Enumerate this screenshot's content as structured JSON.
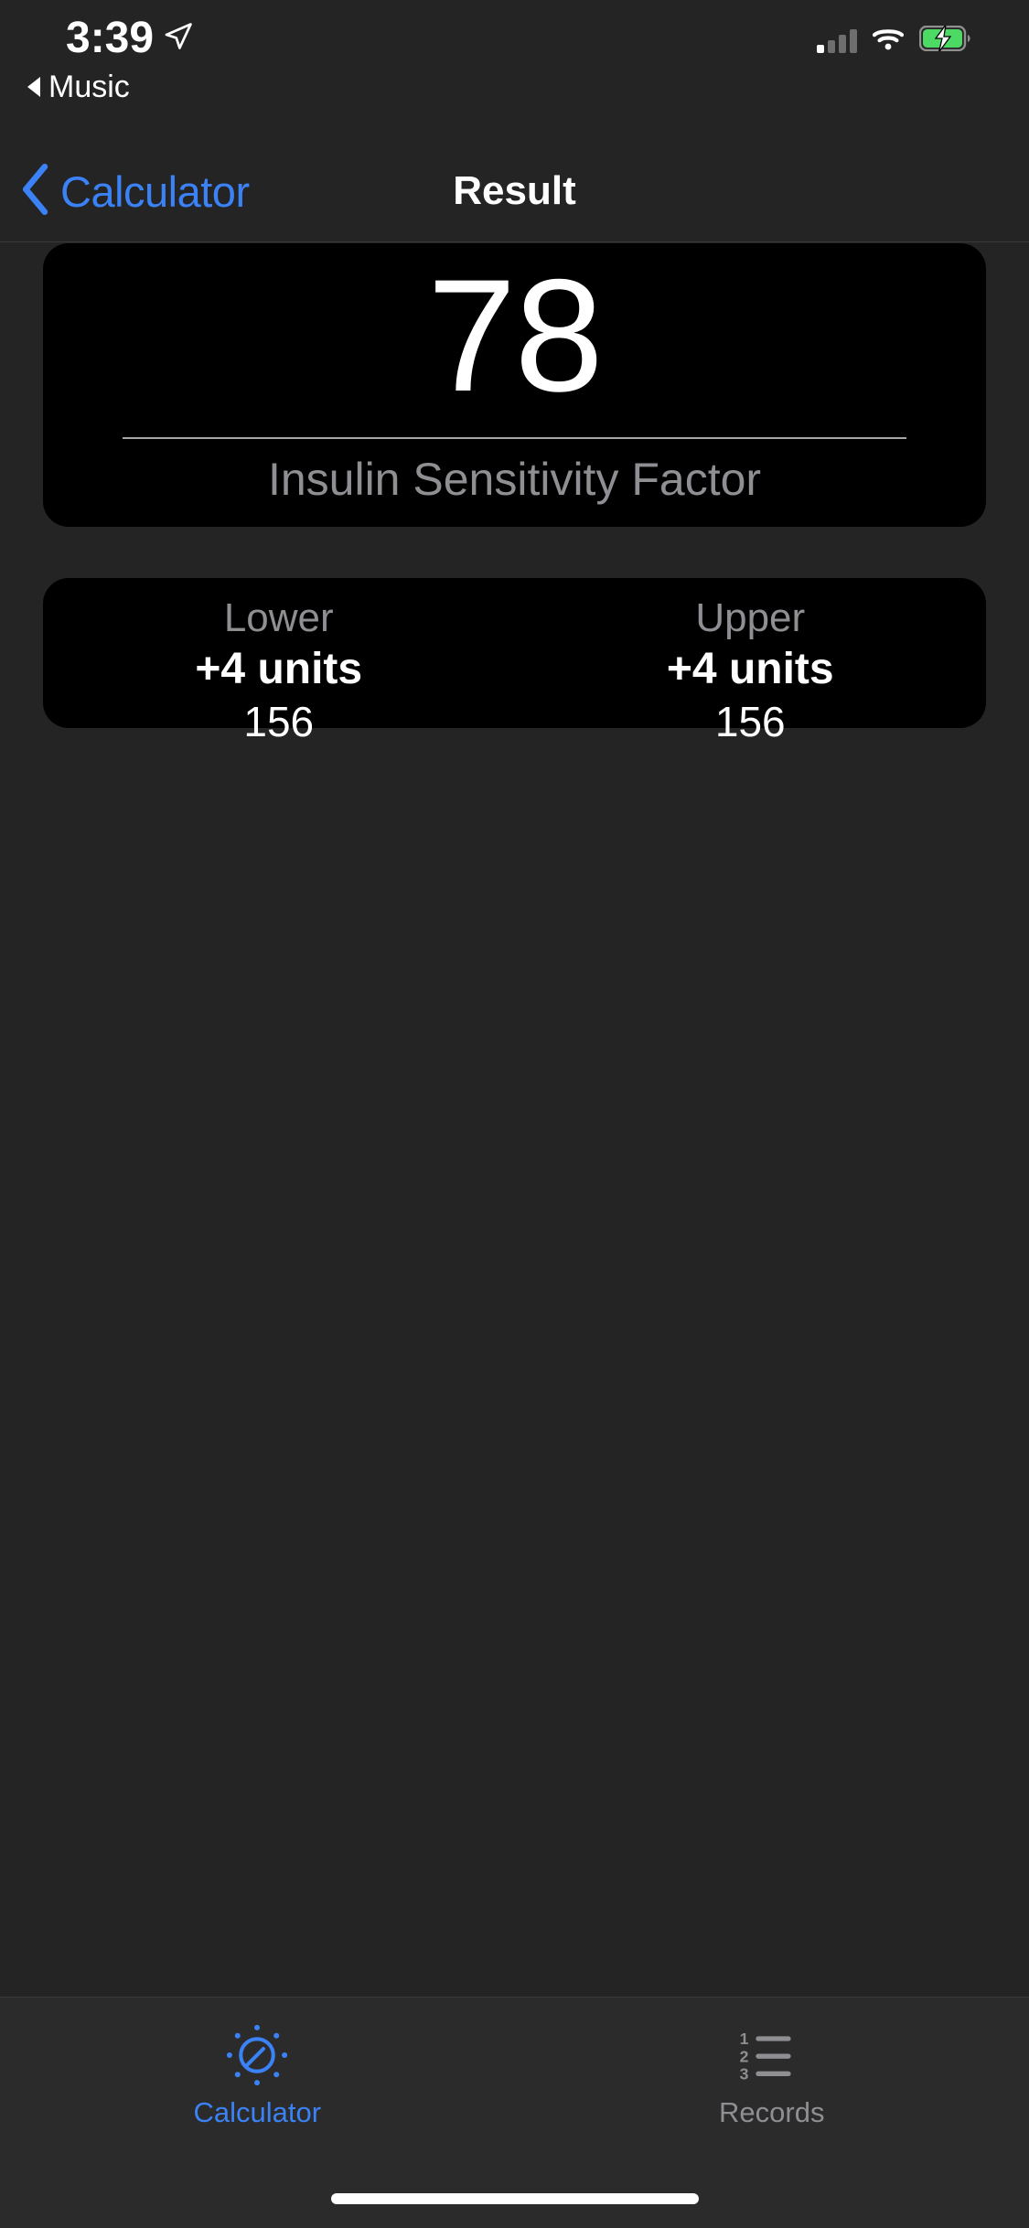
{
  "status_bar": {
    "time": "3:39",
    "location_icon": "location-arrow-icon",
    "back_app_label": "Music",
    "back_app_icon": "triangle-left-icon",
    "signal_icon": "cellular-signal-icon",
    "signal_bars_filled": 1,
    "signal_bars_total": 4,
    "wifi_icon": "wifi-icon",
    "battery_icon": "battery-charging-icon",
    "battery_color": "#4cd964"
  },
  "nav_bar": {
    "back_label": "Calculator",
    "back_icon": "chevron-left-icon",
    "title": "Result",
    "accent_color": "#3b82f6"
  },
  "result_card": {
    "value": "78",
    "label": "Insulin Sensitivity Factor"
  },
  "range_card": {
    "columns": [
      {
        "title": "Lower",
        "units": "+4 units",
        "number": "156"
      },
      {
        "title": "Upper",
        "units": "+4 units",
        "number": "156"
      }
    ]
  },
  "tab_bar": {
    "items": [
      {
        "label": "Calculator",
        "icon": "gauge-sun-icon",
        "active": true
      },
      {
        "label": "Records",
        "icon": "numbered-list-icon",
        "active": false
      }
    ],
    "home_indicator": "home-indicator"
  },
  "colors": {
    "background": "#242424",
    "card": "#000000",
    "accent": "#3b82f6",
    "secondary_text": "#8e8e93",
    "primary_text": "#ffffff"
  }
}
